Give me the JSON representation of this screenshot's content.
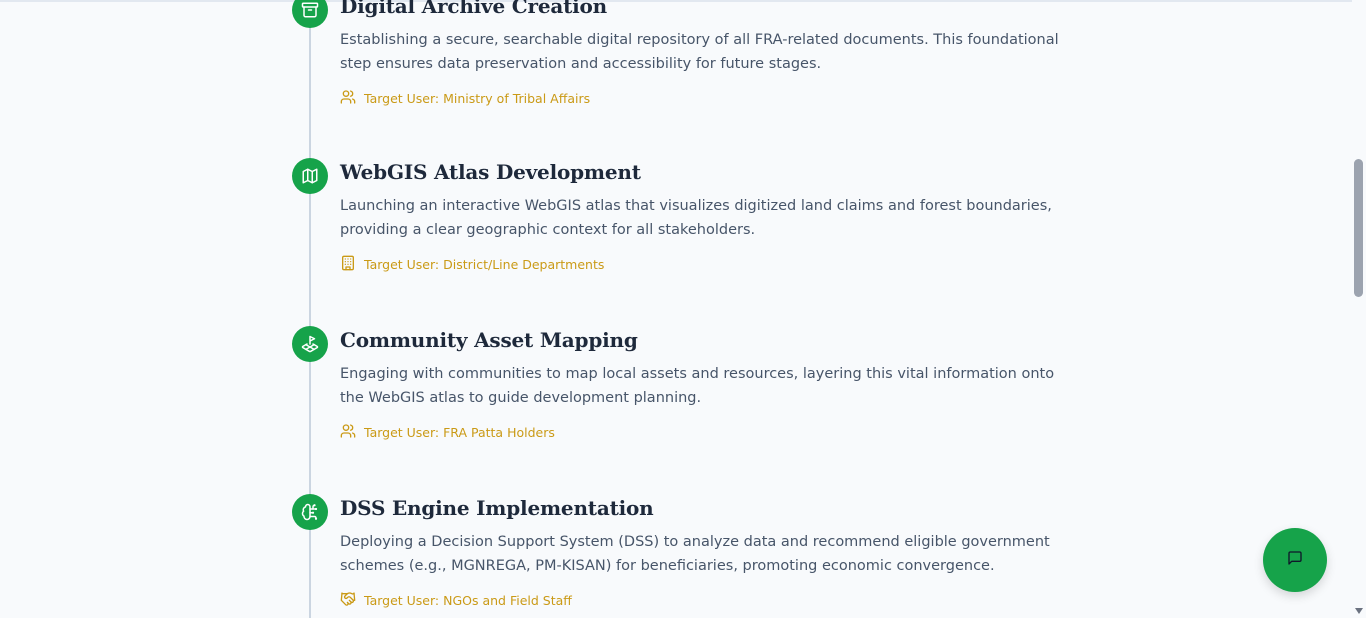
{
  "colors": {
    "accent": "#16a34a",
    "target_text": "#ca9a16",
    "title": "#1e293b",
    "body": "#475569"
  },
  "steps": [
    {
      "icon": "archive-icon",
      "title": "Digital Archive Creation",
      "description": "Establishing a secure, searchable digital repository of all FRA-related documents. This foundational step ensures data preservation and accessibility for future stages.",
      "target_icon": "users-icon",
      "target": "Target User: Ministry of Tribal Affairs"
    },
    {
      "icon": "map-icon",
      "title": "WebGIS Atlas Development",
      "description": "Launching an interactive WebGIS atlas that visualizes digitized land claims and forest boundaries, providing a clear geographic context for all stakeholders.",
      "target_icon": "building-icon",
      "target": "Target User: District/Line Departments"
    },
    {
      "icon": "land-plot-icon",
      "title": "Community Asset Mapping",
      "description": "Engaging with communities to map local assets and resources, layering this vital information onto the WebGIS atlas to guide development planning.",
      "target_icon": "users-icon",
      "target": "Target User: FRA Patta Holders"
    },
    {
      "icon": "brain-circuit-icon",
      "title": "DSS Engine Implementation",
      "description": "Deploying a Decision Support System (DSS) to analyze data and recommend eligible government schemes (e.g., MGNREGA, PM-KISAN) for beneficiaries, promoting economic convergence.",
      "target_icon": "handshake-icon",
      "target": "Target User: NGOs and Field Staff"
    }
  ],
  "chat_button": {
    "icon": "chat-icon"
  }
}
